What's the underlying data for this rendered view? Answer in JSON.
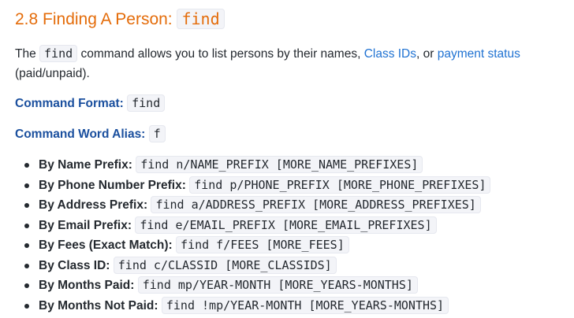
{
  "heading": {
    "text": "2.8 Finding A Person: ",
    "code": "find"
  },
  "intro": {
    "before_code": "The ",
    "code": "find",
    "middle": " command allows you to list persons by their names, ",
    "link_class_ids": "Class IDs",
    "comma_or": ", or ",
    "link_payment_status": "payment status",
    "tail": " (paid/unpaid)."
  },
  "command_format": {
    "label": "Command Format:",
    "value": "find"
  },
  "command_alias": {
    "label": "Command Word Alias:",
    "value": "f"
  },
  "options": [
    {
      "label": "By Name Prefix:",
      "code": "find n/NAME_PREFIX [MORE_NAME_PREFIXES]"
    },
    {
      "label": "By Phone Number Prefix:",
      "code": "find p/PHONE_PREFIX [MORE_PHONE_PREFIXES]"
    },
    {
      "label": "By Address Prefix:",
      "code": "find a/ADDRESS_PREFIX [MORE_ADDRESS_PREFIXES]"
    },
    {
      "label": "By Email Prefix:",
      "code": "find e/EMAIL_PREFIX [MORE_EMAIL_PREFIXES]"
    },
    {
      "label": "By Fees (Exact Match):",
      "code": "find f/FEES [MORE_FEES]"
    },
    {
      "label": "By Class ID:",
      "code": "find c/CLASSID [MORE_CLASSIDS]"
    },
    {
      "label": "By Months Paid:",
      "code": "find mp/YEAR-MONTH [MORE_YEARS-MONTHS]"
    },
    {
      "label": "By Months Not Paid:",
      "code": "find !mp/YEAR-MONTH [MORE_YEARS-MONTHS]"
    }
  ],
  "colors": {
    "heading": "#e46c0a",
    "link": "#1f72d2",
    "label": "#1a4f9e",
    "code_bg": "#f3f4f8"
  }
}
